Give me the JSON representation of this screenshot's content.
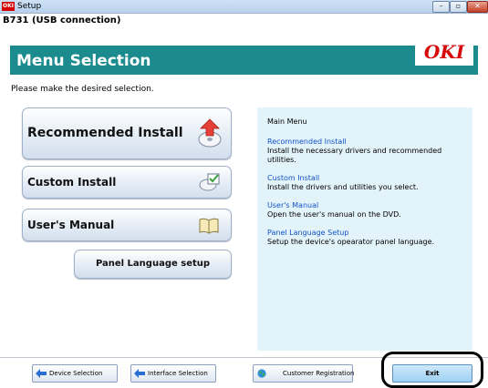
{
  "window": {
    "title": "Setup",
    "app_icon": "OKI"
  },
  "device_line": "B731 (USB connection)",
  "header": {
    "title": "Menu Selection",
    "brand": "OKI",
    "accent_color": "#1c8b8e",
    "brand_color": "#d60a0a"
  },
  "instruction": "Please make the desired selection.",
  "buttons": {
    "recommended": {
      "label": "Recommended Install",
      "icon": "disc-install-icon"
    },
    "custom": {
      "label": "Custom Install",
      "icon": "checklist-icon"
    },
    "manual": {
      "label": "User's Manual",
      "icon": "open-book-icon"
    },
    "panel_language": {
      "label": "Panel Language setup"
    }
  },
  "info_panel": {
    "heading": "Main Menu",
    "items": [
      {
        "link": "Recommended Install",
        "desc": "Install the necessary drivers and recommended utilities."
      },
      {
        "link": "Custom Install",
        "desc": "Install the drivers and utilities you select."
      },
      {
        "link": "User's Manual",
        "desc": "Open the user's manual on the DVD."
      },
      {
        "link": "Panel Language Setup",
        "desc": "Setup the device's opearator panel language."
      }
    ]
  },
  "footer": {
    "device_selection": "Device Selection",
    "interface_selection": "Interface Selection",
    "customer_registration": "Customer Registration",
    "exit": "Exit"
  }
}
